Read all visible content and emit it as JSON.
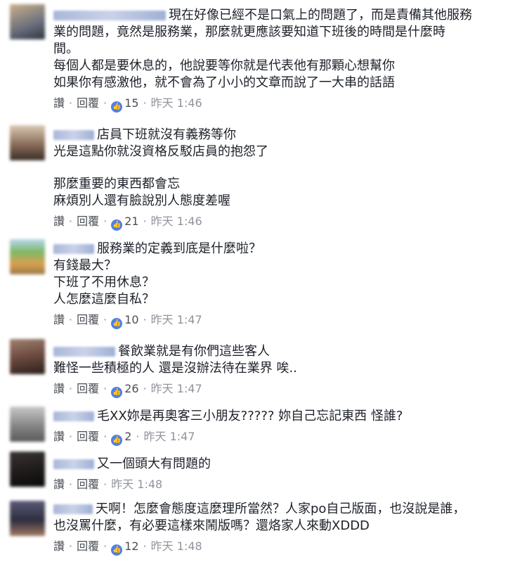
{
  "actions": {
    "like": "讚",
    "reply": "回覆"
  },
  "colors": {
    "link": "#4b4f56",
    "time": "#90949c",
    "like_badge": "#4f7fe8"
  },
  "comments": [
    {
      "lines": [
        "現在好像已經不是口氣上的問題了，而是責備其他服務",
        "業的問題，竟然是服務業，那麼就更應該要知道下班後的時間是什麼時",
        "間。",
        "每個人都是要休息的，他說要等你就是代表他有那顆心想幫你",
        "如果你有感激他，就不會為了小小的文章而說了一大串的話語"
      ],
      "likes": "15",
      "time": "昨天 1:46"
    },
    {
      "lines": [
        "店員下班就沒有義務等你",
        "光是這點你就沒資格反駁店員的抱怨了",
        "",
        "那麼重要的東西都會忘",
        "麻煩別人還有臉說別人態度差喔"
      ],
      "likes": "21",
      "time": "昨天 1:46"
    },
    {
      "lines": [
        "服務業的定義到底是什麼啦？",
        "有錢最大？",
        "下班了不用休息？",
        "人怎麼這麼自私？"
      ],
      "likes": "10",
      "time": "昨天 1:47"
    },
    {
      "lines": [
        "餐飲業就是有你們這些客人",
        "難怪一些積極的人 還是沒辦法待在業界 唉.."
      ],
      "likes": "26",
      "time": "昨天 1:47"
    },
    {
      "lines": [
        "毛XX妳是再奧客三小朋友????? 妳自己忘記東西 怪誰?"
      ],
      "likes": "2",
      "time": "昨天 1:47"
    },
    {
      "lines": [
        "又一個頭大有問題的"
      ],
      "likes": "",
      "time": "昨天 1:48"
    },
    {
      "lines": [
        "天啊！怎麼會態度這麼理所當然？人家po自己版面，也沒說是誰，",
        "也沒罵什麼，有必要這樣來鬧版嗎？還烙家人來動XDDD"
      ],
      "likes": "12",
      "time": "昨天 1:48"
    }
  ]
}
